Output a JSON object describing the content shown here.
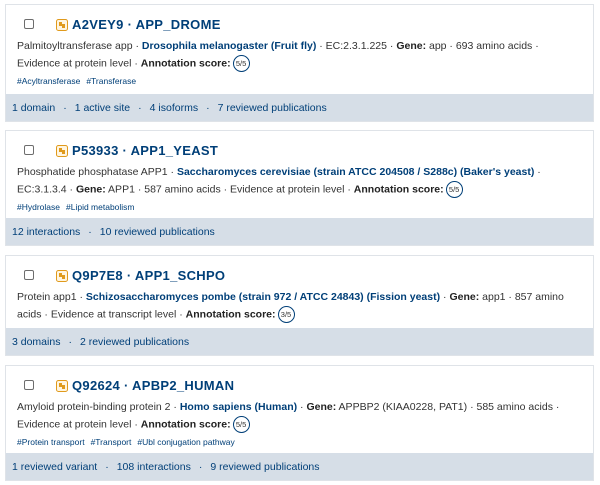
{
  "entries": [
    {
      "title": "A2VEY9 · APP_DROME",
      "desc_pre": "Palmitoyltransferase app · ",
      "organism": "Drosophila melanogaster (Fruit fly)",
      "desc_mid1": " · EC:2.3.1.225 · ",
      "gene_label": "Gene:",
      "desc_mid2": " app · 693 amino acids · Evidence at protein level · ",
      "score_label": "Annotation score:",
      "score": "5/5",
      "tags": [
        "#Acyltransferase",
        "#Transferase"
      ],
      "stats": [
        "1 domain",
        "1 active site",
        "4 isoforms",
        "7 reviewed publications"
      ]
    },
    {
      "title": "P53933 · APP1_YEAST",
      "desc_pre": "Phosphatide phosphatase APP1 · ",
      "organism": "Saccharomyces cerevisiae (strain ATCC 204508 / S288c) (Baker's yeast)",
      "desc_mid1": " · EC:3.1.3.4 · ",
      "gene_label": "Gene:",
      "desc_mid2": " APP1 · 587 amino acids · Evidence at protein level · ",
      "score_label": "Annotation score:",
      "score": "5/5",
      "tags": [
        "#Hydrolase",
        "#Lipid metabolism"
      ],
      "stats": [
        "12 interactions",
        "10 reviewed publications"
      ]
    },
    {
      "title": "Q9P7E8 · APP1_SCHPO",
      "desc_pre": "Protein app1 · ",
      "organism": "Schizosaccharomyces pombe (strain 972 / ATCC 24843) (Fission yeast)",
      "desc_mid1": " · ",
      "gene_label": "Gene:",
      "desc_mid2": " app1 · 857 amino acids · Evidence at transcript level · ",
      "score_label": "Annotation score:",
      "score": "3/5",
      "tags": [],
      "stats": [
        "3 domains",
        "2 reviewed publications"
      ]
    },
    {
      "title": "Q92624 · APBP2_HUMAN",
      "desc_pre": "Amyloid protein-binding protein 2 · ",
      "organism": "Homo sapiens (Human)",
      "desc_mid1": " · ",
      "gene_label": "Gene:",
      "desc_mid2": " APPBP2 (KIAA0228, PAT1) · 585 amino acids · Evidence at protein level · ",
      "score_label": "Annotation score:",
      "score": "5/5",
      "tags": [
        "#Protein transport",
        "#Transport",
        "#Ubl conjugation pathway"
      ],
      "stats": [
        "1 reviewed variant",
        "108 interactions",
        "9 reviewed publications"
      ]
    }
  ],
  "colors": {
    "link": "#003f78",
    "footer_bg": "#d6dee7",
    "star": "#e09a1c"
  },
  "icons": {
    "reviewed": "reviewed-star-icon"
  }
}
